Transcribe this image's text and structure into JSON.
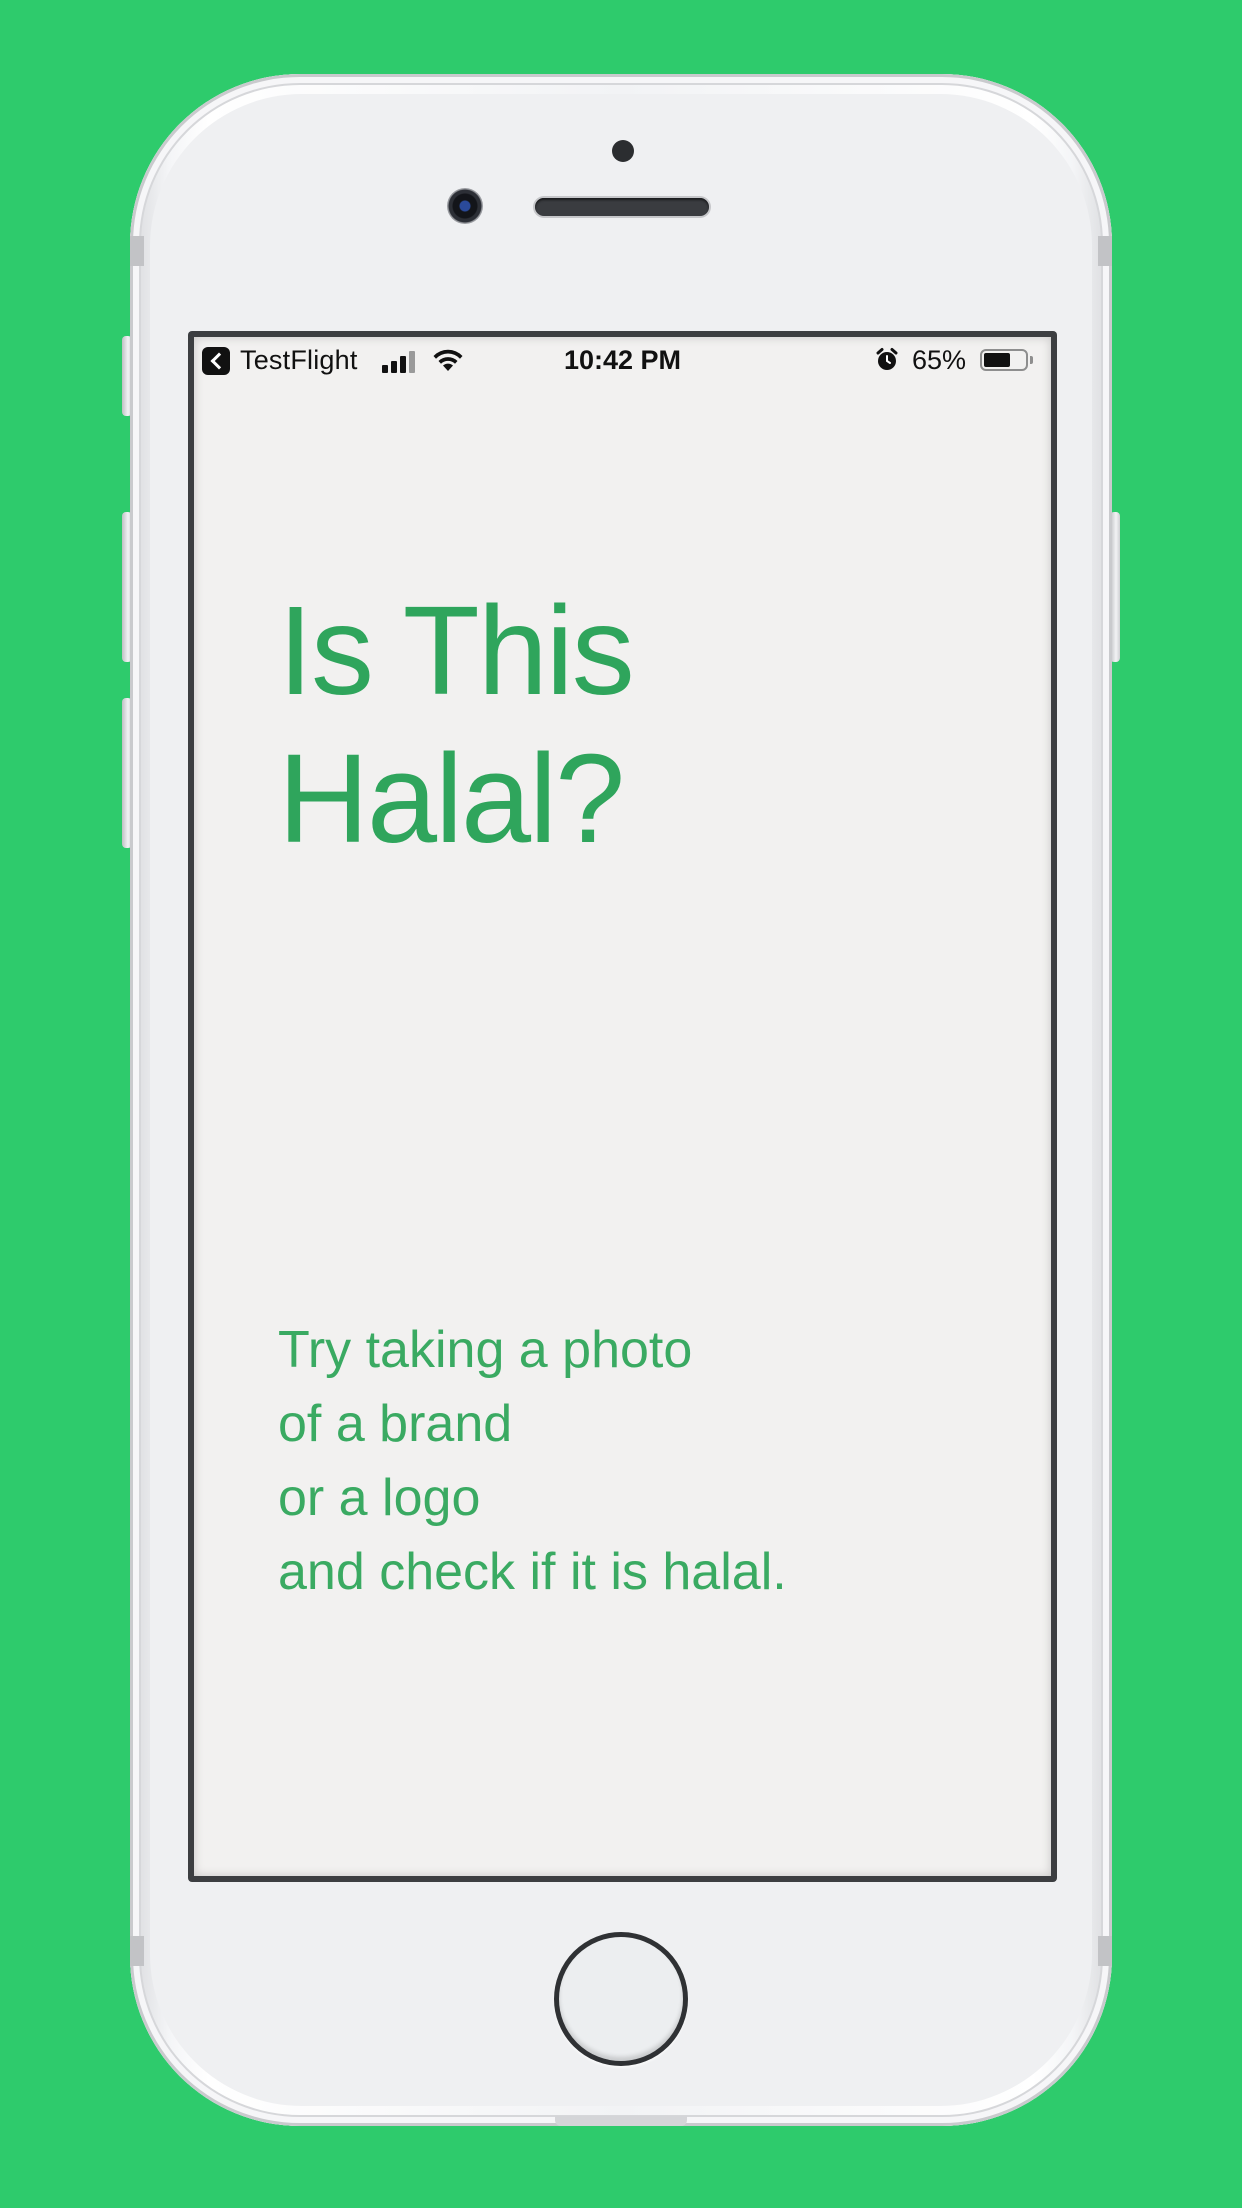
{
  "status_bar": {
    "back_app": "TestFlight",
    "time": "10:42 PM",
    "battery_percent": "65%",
    "battery_level": 0.65,
    "icons": [
      "back-arrow-icon",
      "cellular-signal-icon",
      "wifi-icon",
      "alarm-icon",
      "battery-icon"
    ]
  },
  "main": {
    "title_lines": [
      "Is This",
      "Halal?"
    ],
    "instruction_lines": [
      "Try taking a photo",
      "of a brand",
      "or a logo",
      "and check if it is halal."
    ]
  },
  "colors": {
    "background": "#2ecb6c",
    "accent_text": "#2fa55c",
    "screen_bg": "#f2f1f0"
  }
}
